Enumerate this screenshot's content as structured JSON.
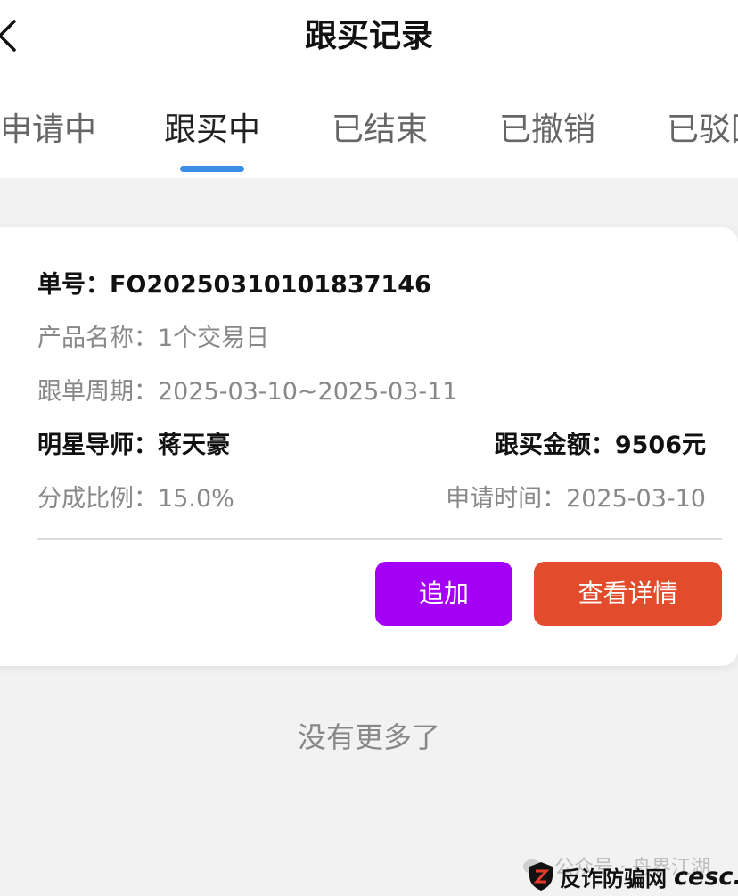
{
  "header": {
    "title": "跟买记录",
    "back_icon": "chevron-left-icon"
  },
  "tabs": [
    {
      "label": "申请中",
      "active": false
    },
    {
      "label": "跟买中",
      "active": true
    },
    {
      "label": "已结束",
      "active": false
    },
    {
      "label": "已撤销",
      "active": false
    },
    {
      "label": "已驳回",
      "active": false
    }
  ],
  "order": {
    "number_label": "单号：",
    "number": "FO20250310101837146",
    "product_label": "产品名称：",
    "product": "1个交易日",
    "period_label": "跟单周期：",
    "period": "2025-03-10~2025-03-11",
    "mentor_label": "明星导师：",
    "mentor": "蒋天豪",
    "amount_label": "跟买金额：",
    "amount": "9506元",
    "share_label": "分成比例：",
    "share": "15.0%",
    "apply_time_label": "申请时间：",
    "apply_time": "2025-03-10"
  },
  "actions": {
    "add_label": "追加",
    "detail_label": "查看详情"
  },
  "list_end": "没有更多了",
  "watermarks": {
    "wechat": "公众号 · 舟界江湖",
    "site_name": "反诈防骗网",
    "site_brand": "cesc.cc"
  },
  "colors": {
    "accent_tab": "#3b8ee4",
    "add_button": "#a300f5",
    "detail_button": "#e24c2d"
  }
}
